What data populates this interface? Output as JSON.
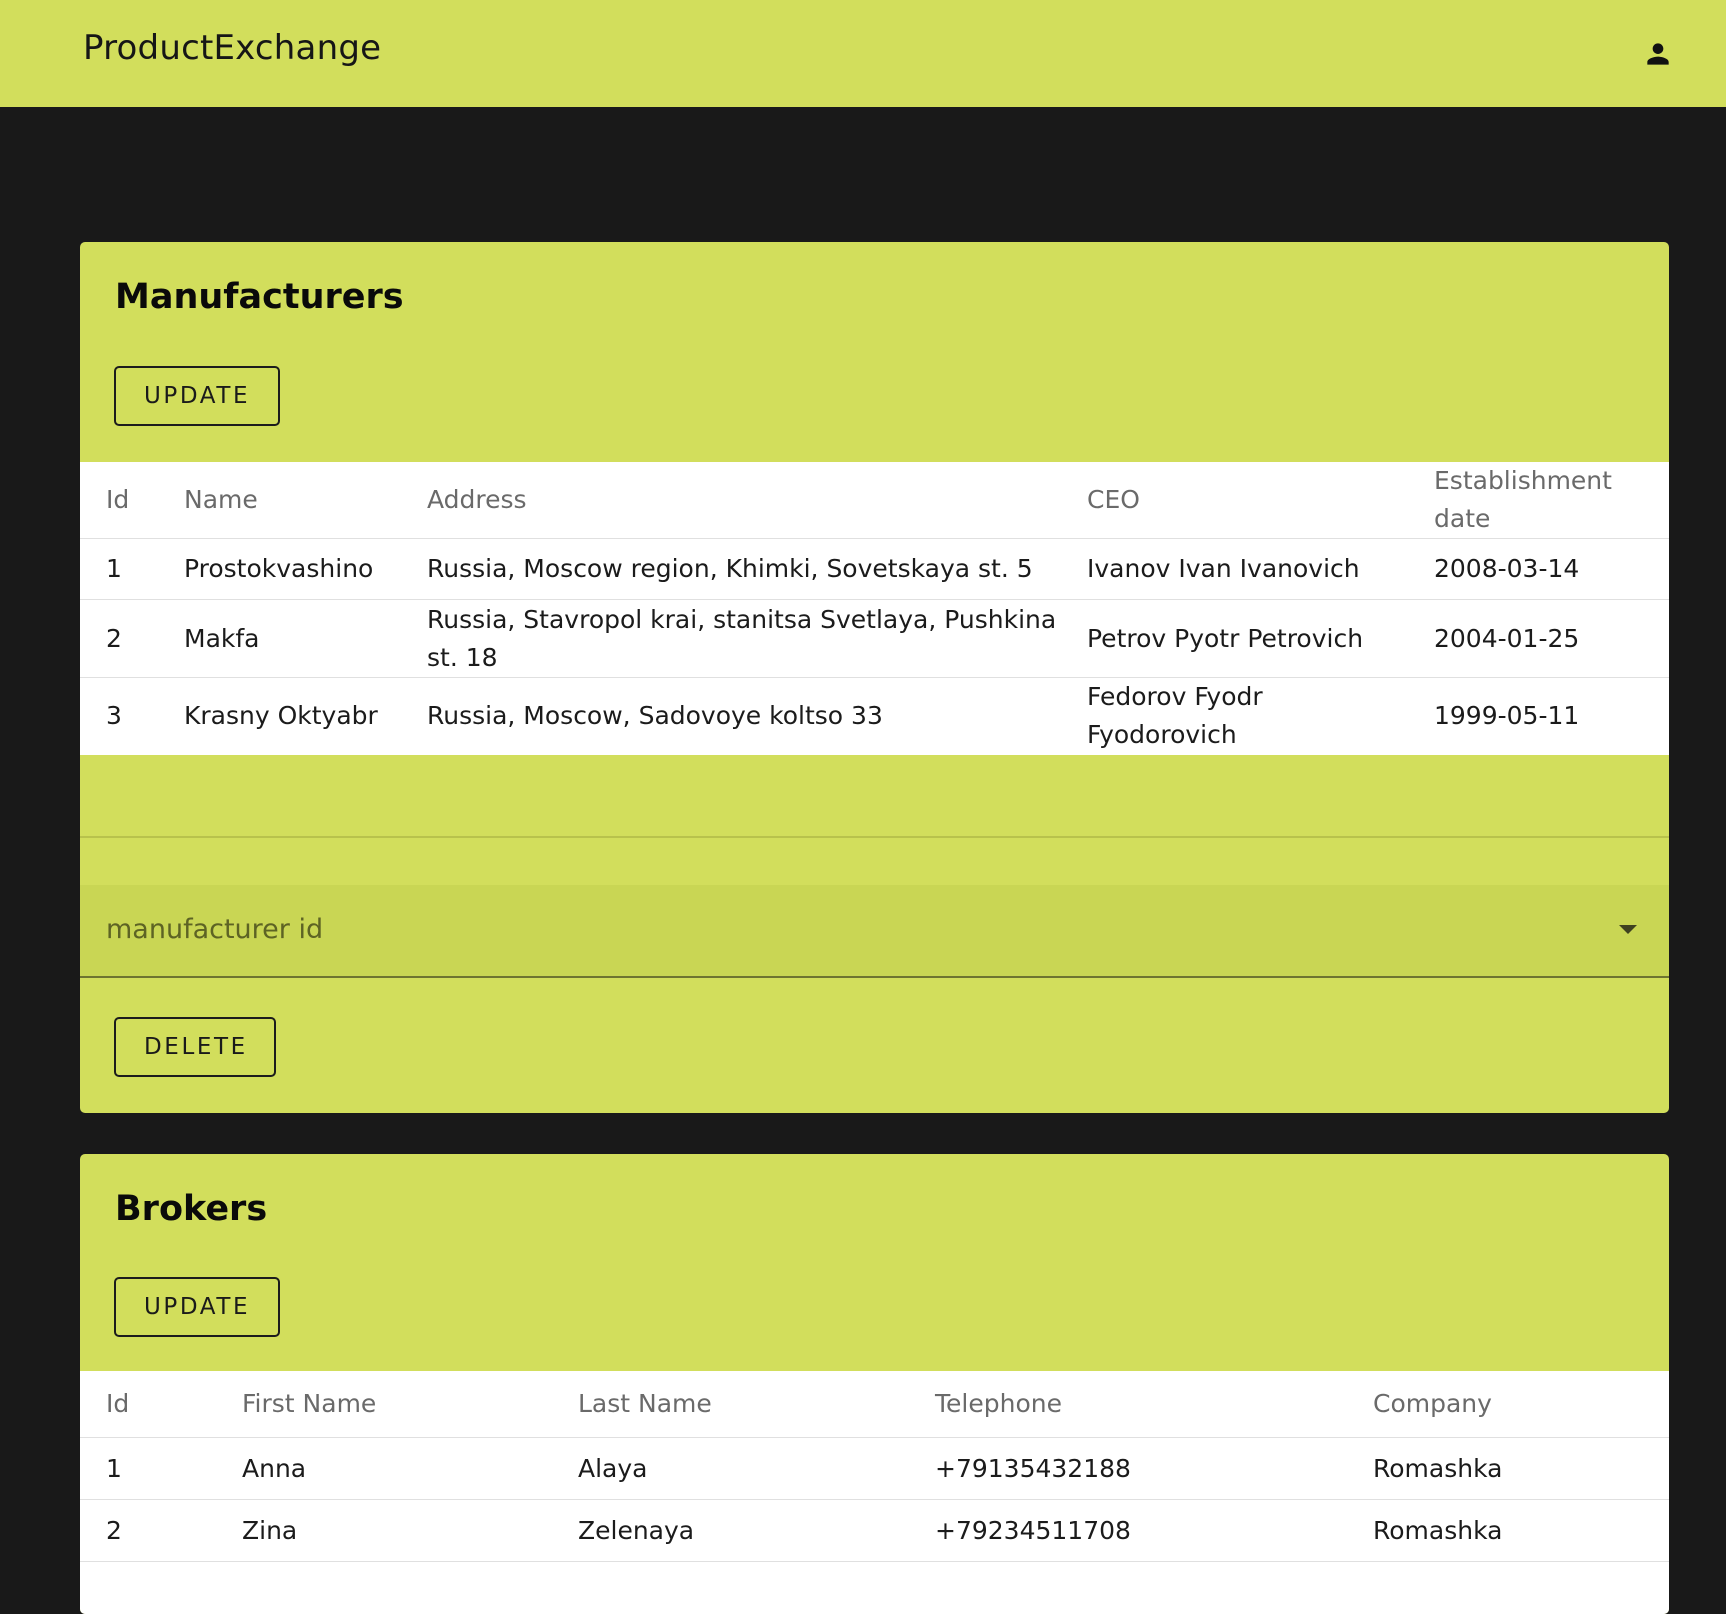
{
  "appbar": {
    "title": "ProductExchange",
    "account_icon": "person-icon"
  },
  "manufacturers": {
    "title": "Manufacturers",
    "update_label": "UPDATE",
    "columns": [
      "Id",
      "Name",
      "Address",
      "CEO",
      "Establishment date"
    ],
    "rows": [
      [
        "1",
        "Prostokvashino",
        "Russia, Moscow region, Khimki, Sovetskaya st. 5",
        "Ivanov Ivan Ivanovich",
        "2008-03-14"
      ],
      [
        "2",
        "Makfa",
        "Russia, Stavropol krai, stanitsa Svetlaya, Pushkina st. 18",
        "Petrov Pyotr Petrovich",
        "2004-01-25"
      ],
      [
        "3",
        "Krasny Oktyabr",
        "Russia, Moscow, Sadovoye koltso 33",
        "Fedorov Fyodr Fyodorovich",
        "1999-05-11"
      ]
    ],
    "select_label": "manufacturer id",
    "delete_label": "DELETE"
  },
  "brokers": {
    "title": "Brokers",
    "update_label": "UPDATE",
    "columns": [
      "Id",
      "First Name",
      "Last Name",
      "Telephone",
      "Company"
    ],
    "rows": [
      [
        "1",
        "Anna",
        "Alaya",
        "+79135432188",
        "Romashka"
      ],
      [
        "2",
        "Zina",
        "Zelenaya",
        "+79234511708",
        "Romashka"
      ]
    ]
  },
  "colors": {
    "accent": "#d2de5c",
    "background": "#191919",
    "table_background": "#ffffff"
  }
}
